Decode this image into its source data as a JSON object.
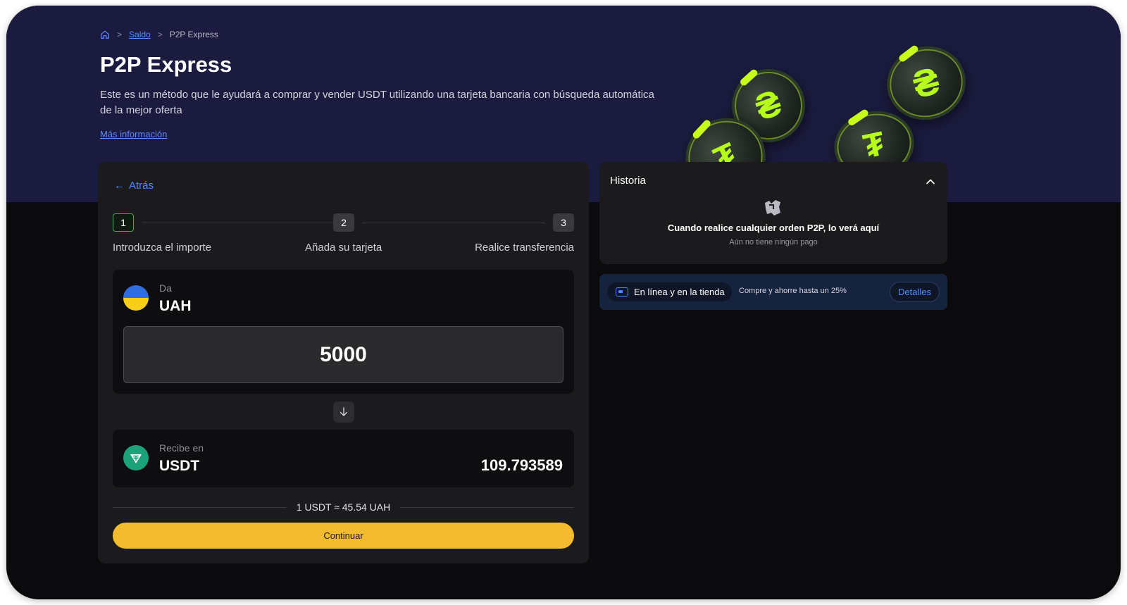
{
  "breadcrumb": {
    "home_icon": "home-icon",
    "items": [
      "Saldo",
      "P2P Express"
    ]
  },
  "header": {
    "title": "P2P Express",
    "description": "Este es un método que le ayudará a comprar y vender USDT utilizando una tarjeta bancaria con búsqueda automática de la mejor oferta",
    "more_link": "Más información"
  },
  "converter": {
    "back_label": "Atrás",
    "steps": [
      {
        "number": "1",
        "label": "Introduzca el importe",
        "active": true
      },
      {
        "number": "2",
        "label": "Añada su tarjeta",
        "active": false
      },
      {
        "number": "3",
        "label": "Realice transferencia",
        "active": false
      }
    ],
    "give": {
      "caption": "Da",
      "currency": "UAH",
      "amount": "5000",
      "icon": "ukraine-flag-icon"
    },
    "receive": {
      "caption": "Recibe en",
      "currency": "USDT",
      "amount": "109.793589",
      "icon": "tether-icon"
    },
    "rate": "1 USDT ≈ 45.54 UAH",
    "continue_label": "Continuar"
  },
  "history": {
    "title": "Historia",
    "empty_title": "Cuando realice cualquier orden P2P, lo verá aquí",
    "empty_subtitle": "Aún no tiene ningún pago"
  },
  "promo": {
    "chip_label": "En línea y en la tienda",
    "text": "Compre y ahorre hasta un 25%",
    "details_label": "Detalles"
  },
  "colors": {
    "hero_bg": "#1b1b3f",
    "accent_blue": "#4d8bff",
    "button_yellow": "#f3bc2e",
    "coin_green": "#b6ff1a"
  }
}
